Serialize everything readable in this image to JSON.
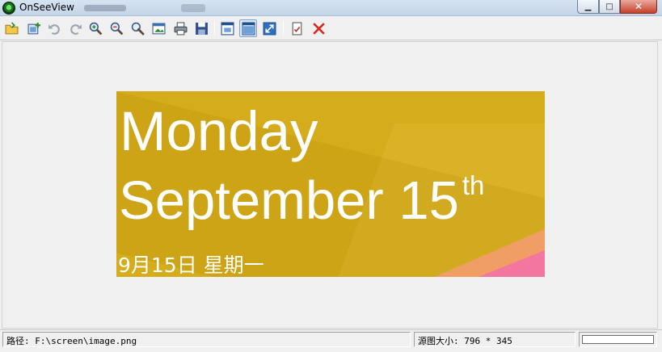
{
  "window": {
    "title": "OnSeeView",
    "minimize_glyph": "▁",
    "maximize_glyph": "□",
    "close_glyph": "✕"
  },
  "toolbar": {
    "buttons": [
      {
        "name": "open-folder-icon",
        "tooltip": ""
      },
      {
        "name": "add-image-icon",
        "tooltip": ""
      },
      {
        "name": "undo-icon",
        "tooltip": ""
      },
      {
        "name": "redo-icon",
        "tooltip": ""
      },
      {
        "name": "zoom-in-icon",
        "tooltip": ""
      },
      {
        "name": "zoom-out-icon",
        "tooltip": ""
      },
      {
        "name": "magic-wand-icon",
        "tooltip": ""
      },
      {
        "name": "image-properties-icon",
        "tooltip": ""
      },
      {
        "name": "print-icon",
        "tooltip": ""
      },
      {
        "name": "save-icon",
        "tooltip": ""
      },
      {
        "name": "window-fit-icon",
        "tooltip": ""
      },
      {
        "name": "actual-size-icon",
        "tooltip": ""
      },
      {
        "name": "fullscreen-icon",
        "tooltip": ""
      },
      {
        "name": "notes-icon",
        "tooltip": ""
      },
      {
        "name": "close-image-icon",
        "tooltip": ""
      }
    ],
    "pressed_button": "actual-size-icon"
  },
  "image": {
    "day": "Monday",
    "date": "September 15",
    "date_suffix": "th",
    "chinese_date": "9月15日  星期一",
    "colors": {
      "background": "#d5ad1c",
      "salmon": "#f59b72",
      "pink": "#f276a0",
      "text": "#ffffff"
    }
  },
  "status": {
    "path": "路径: F:\\screen\\image.png",
    "size": "源图大小: 796 * 345",
    "progress": 0
  }
}
